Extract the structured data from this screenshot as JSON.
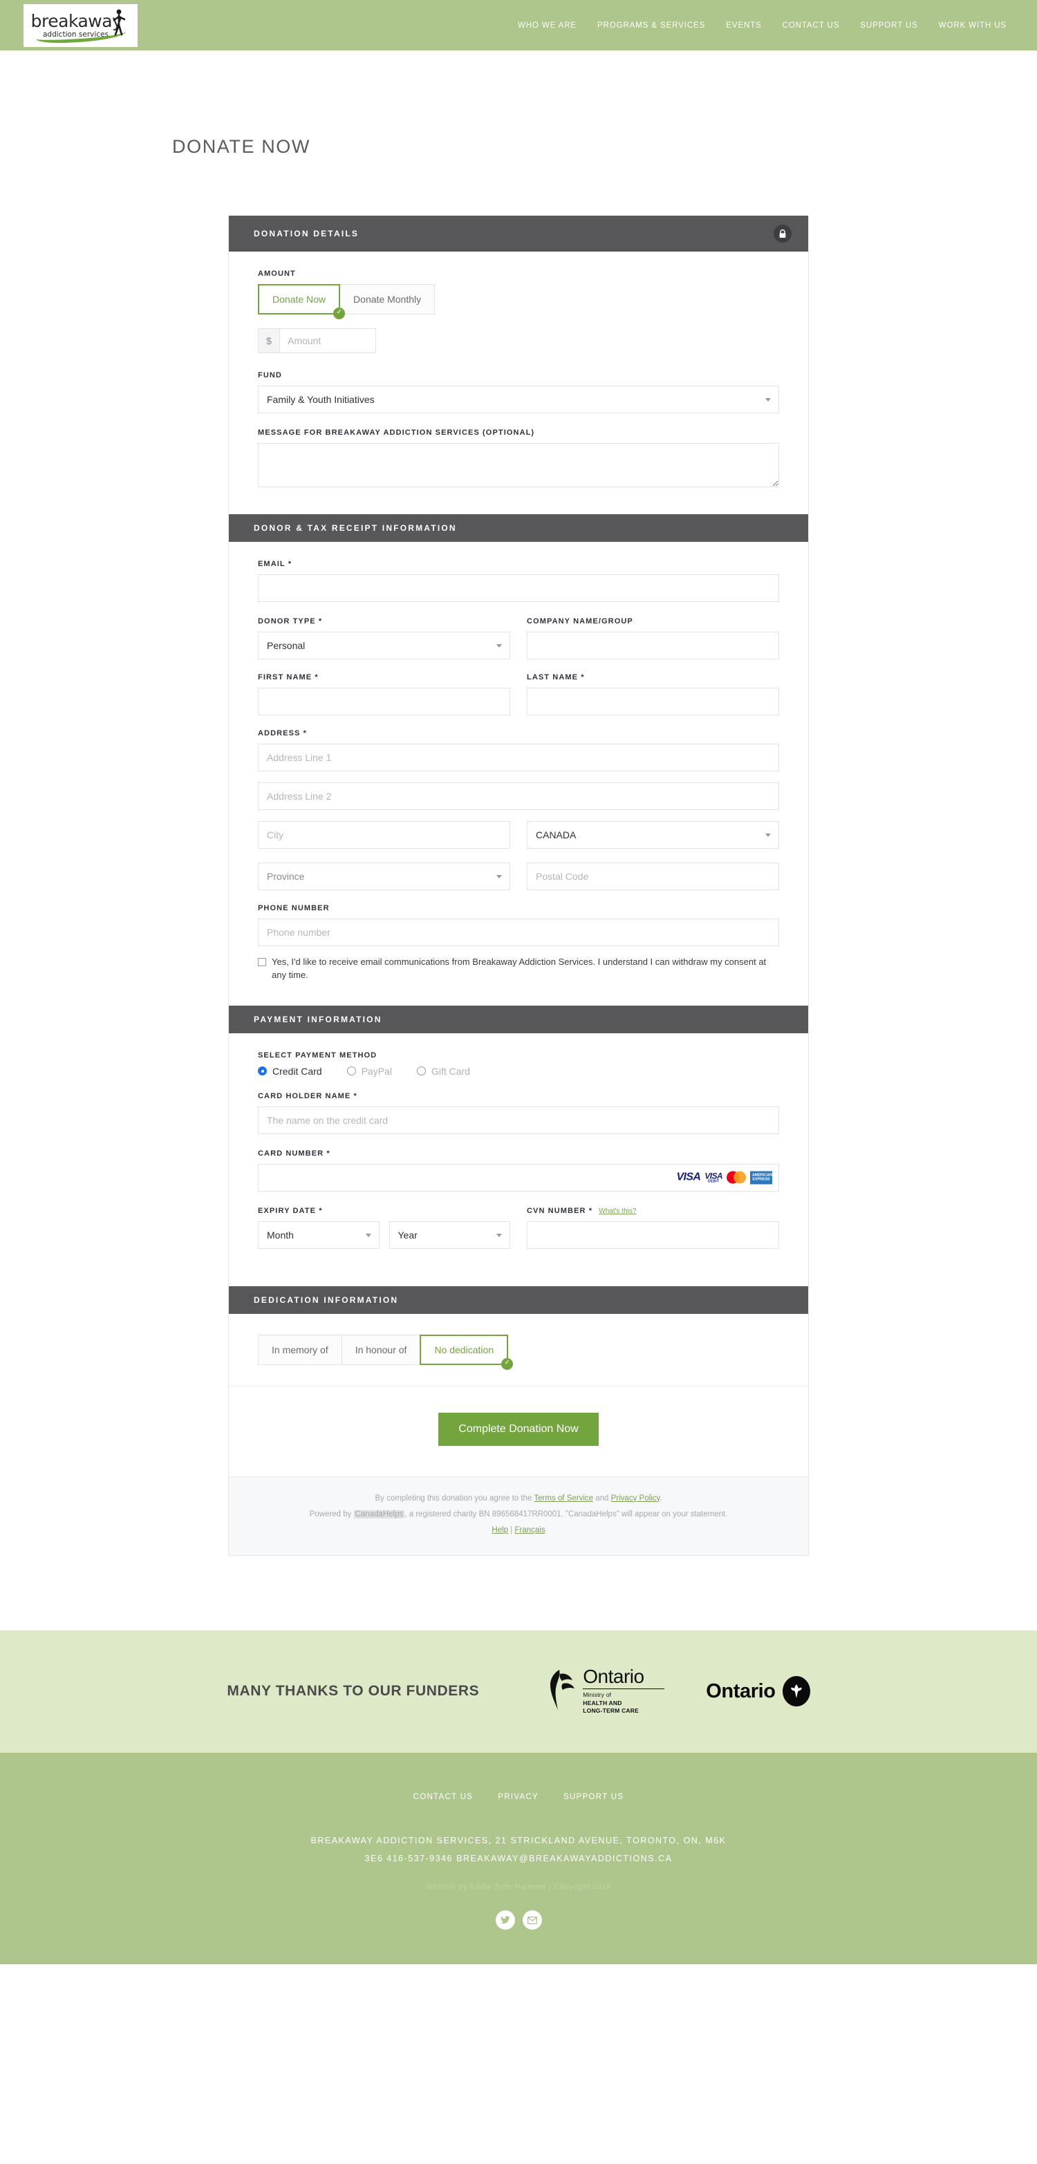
{
  "header": {
    "logo": {
      "word": "breakaway",
      "sub": "addiction services"
    },
    "nav": [
      {
        "label": "WHO WE ARE"
      },
      {
        "label": "PROGRAMS & SERVICES"
      },
      {
        "label": "EVENTS"
      },
      {
        "label": "CONTACT US"
      },
      {
        "label": "SUPPORT US"
      },
      {
        "label": "WORK WITH US"
      }
    ]
  },
  "page": {
    "title": "DONATE NOW"
  },
  "donation_details": {
    "heading": "DONATION DETAILS",
    "amount_label": "AMOUNT",
    "frequency_options": [
      {
        "label": "Donate Now",
        "selected": true
      },
      {
        "label": "Donate Monthly",
        "selected": false
      }
    ],
    "currency_prefix": "$",
    "amount_placeholder": "Amount",
    "amount_value": "",
    "fund_label": "FUND",
    "fund_value": "Family & Youth Initiatives",
    "message_label": "MESSAGE FOR BREAKAWAY ADDICTION SERVICES (OPTIONAL)",
    "message_value": ""
  },
  "donor_info": {
    "heading": "DONOR & TAX RECEIPT INFORMATION",
    "email_label": "EMAIL",
    "email_value": "",
    "donor_type_label": "DONOR TYPE",
    "donor_type_value": "Personal",
    "company_label": "COMPANY NAME/GROUP",
    "company_value": "",
    "first_name_label": "FIRST NAME",
    "first_name_value": "",
    "last_name_label": "LAST NAME",
    "last_name_value": "",
    "address_label": "ADDRESS",
    "address1_placeholder": "Address Line 1",
    "address2_placeholder": "Address Line 2",
    "city_placeholder": "City",
    "country_value": "CANADA",
    "province_value": "Province",
    "postal_placeholder": "Postal Code",
    "phone_label": "PHONE NUMBER",
    "phone_placeholder": "Phone number",
    "consent_text": "Yes, I'd like to receive email communications from Breakaway Addiction Services. I understand I can withdraw my consent at any time.",
    "required_mark": "*"
  },
  "payment": {
    "heading": "PAYMENT INFORMATION",
    "method_label": "SELECT PAYMENT METHOD",
    "methods": [
      {
        "label": "Credit Card",
        "selected": true,
        "disabled": false
      },
      {
        "label": "PayPal",
        "selected": false,
        "disabled": true
      },
      {
        "label": "Gift Card",
        "selected": false,
        "disabled": true
      }
    ],
    "card_holder_label": "CARD HOLDER NAME",
    "card_holder_placeholder": "The name on the credit card",
    "card_number_label": "CARD NUMBER",
    "card_number_value": "",
    "card_brands": [
      "VISA",
      "VISA DEBIT",
      "mastercard",
      "AMERICAN EXPRESS"
    ],
    "expiry_label": "EXPIRY DATE",
    "month_value": "Month",
    "year_value": "Year",
    "cvn_label": "CVN NUMBER",
    "cvn_help": "What's this?",
    "cvn_value": ""
  },
  "dedication": {
    "heading": "DEDICATION INFORMATION",
    "options": [
      {
        "label": "In memory of",
        "selected": false
      },
      {
        "label": "In honour of",
        "selected": false
      },
      {
        "label": "No dedication",
        "selected": true
      }
    ]
  },
  "submit": {
    "label": "Complete Donation Now"
  },
  "widget_footer": {
    "terms_prefix": "By completing this donation you agree to the ",
    "terms_link": "Terms of Service",
    "terms_middle": " and ",
    "privacy_link": "Privacy Policy",
    "terms_suffix": ".",
    "powered_prefix": "Powered by ",
    "powered_brand": "CanadaHelps",
    "powered_suffix": ", a registered charity BN 896568417RR0001. \"CanadaHelps\" will appear on your statement.",
    "help_link": "Help",
    "separator": "|",
    "french_link": "Français"
  },
  "funders": {
    "title": "MANY THANKS TO OUR FUNDERS",
    "ontario_ministry": {
      "word": "Ontario",
      "line1": "Ministry of",
      "line2": "HEALTH AND",
      "line3": "LONG-TERM CARE"
    },
    "ontario_brand": {
      "word": "Ontario"
    }
  },
  "site_footer": {
    "nav": [
      {
        "label": "CONTACT US"
      },
      {
        "label": "PRIVACY"
      },
      {
        "label": "SUPPORT US"
      }
    ],
    "address_line1": "BREAKAWAY ADDICTION SERVICES, 21 STRICKLAND AVENUE, TORONTO, ON, M6K",
    "address_line2": "3E6   416-537-9346   BREAKAWAY@BREAKAWAYADDICTIONS.CA",
    "credit": "Website by Eddie Jude Hareven | Copyright 2018",
    "social": [
      {
        "name": "twitter"
      },
      {
        "name": "email"
      }
    ]
  },
  "colors": {
    "brand_green": "#aec58c",
    "accent_green": "#74a43d",
    "funders_bg": "#dde9c7",
    "section_header": "#57575a"
  }
}
